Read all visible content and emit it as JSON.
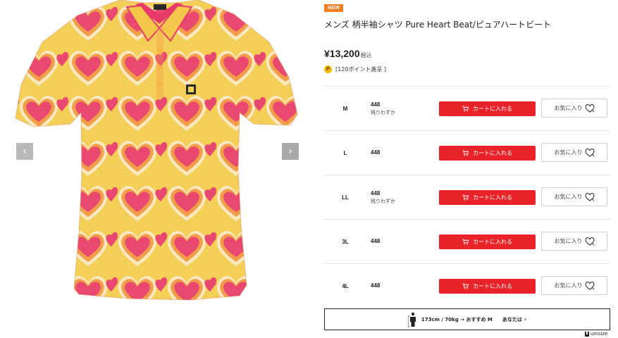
{
  "gallery": {
    "prev_arrow": "‹",
    "next_arrow": "›",
    "shirt_colors": {
      "base": "#f2e38a",
      "pink": "#e73a6a",
      "orange": "#f18a3c",
      "yellow": "#f6d64a",
      "cream": "#fbf1c8"
    }
  },
  "product": {
    "badge": "NEW",
    "title": "メンズ 柄半袖シャツ Pure Heart Beat/ピュアハートビート",
    "price": "¥13,200",
    "tax_label": "税込",
    "points_icon": "P",
    "points_text": "[120ポイント進呈 ]"
  },
  "sizes": [
    {
      "size": "M",
      "code": "448",
      "note": "残りわずか"
    },
    {
      "size": "L",
      "code": "448",
      "note": ""
    },
    {
      "size": "LL",
      "code": "448",
      "note": "残りわずか"
    },
    {
      "size": "3L",
      "code": "448",
      "note": ""
    },
    {
      "size": "4L",
      "code": "448",
      "note": ""
    }
  ],
  "buttons": {
    "cart_label": "カートに入れる",
    "favorite_label": "お気に入り"
  },
  "recommendation": {
    "text": "173cm / 70kg → おすすめ M",
    "you_label": "あなたは",
    "chevron": "›"
  },
  "brand_footer": "unisize",
  "colors": {
    "accent_red": "#e8232a",
    "badge_orange": "#f07d22",
    "points_gold": "#f5b800"
  }
}
